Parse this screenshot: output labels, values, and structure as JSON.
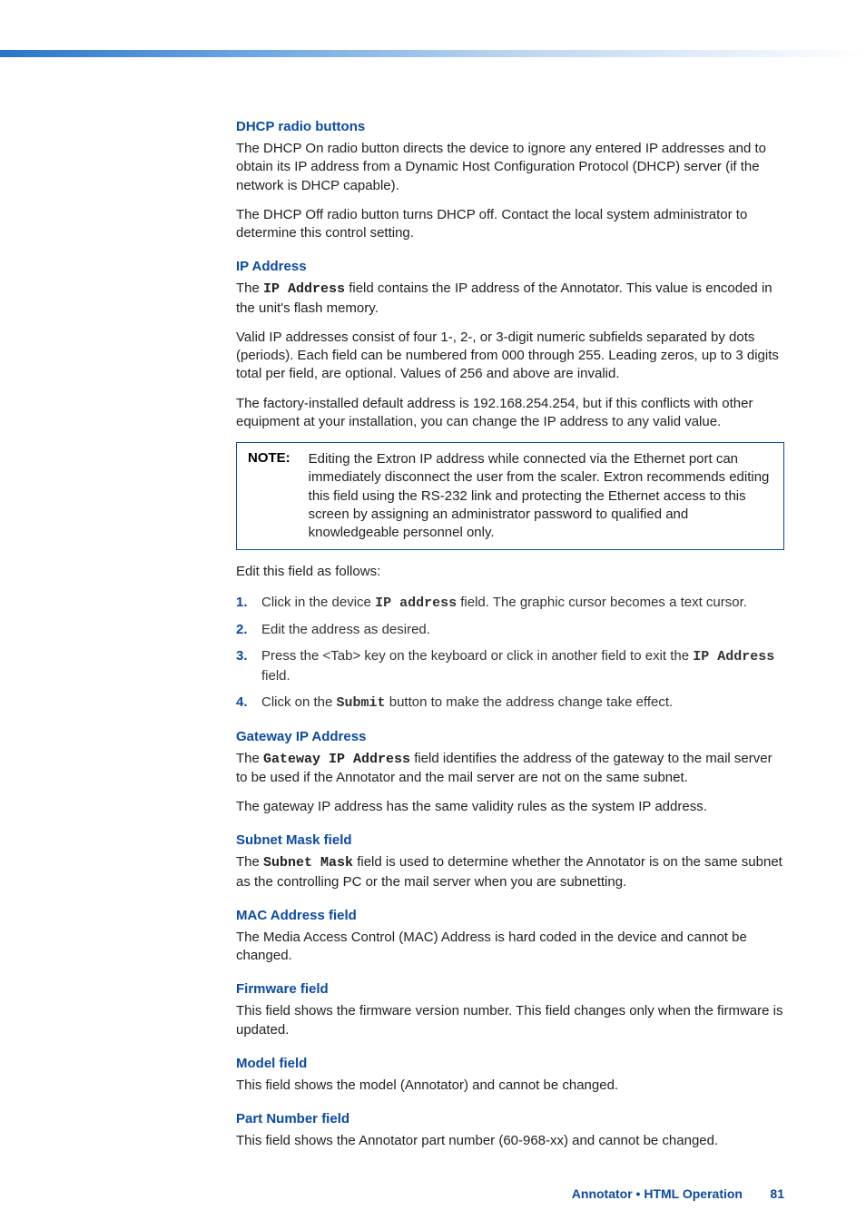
{
  "sections": {
    "dhcp": {
      "head": "DHCP radio buttons",
      "p1": "The DHCP On radio button directs the device to ignore any entered IP addresses and to obtain its IP address from a Dynamic Host Configuration Protocol (DHCP) server (if the network is DHCP capable).",
      "p2": "The DHCP Off radio button turns DHCP off. Contact the local system administrator to determine this control setting."
    },
    "ip": {
      "head": "IP Address",
      "p1_a": "The ",
      "p1_code": "IP Address",
      "p1_b": " field contains the IP address of the Annotator. This value is encoded in the unit's flash memory.",
      "p2": "Valid IP addresses consist of four 1-, 2-, or 3-digit numeric subfields separated by dots (periods). Each field can be numbered from 000 through 255. Leading zeros, up to 3 digits total per field, are optional. Values of 256 and above are invalid.",
      "p3": "The factory-installed default address is 192.168.254.254, but if this conflicts with other equipment at your installation, you can change the IP address to any valid value.",
      "note_label": "NOTE:",
      "note_text": "Editing the Extron IP address while connected via the Ethernet port can immediately disconnect the user from the scaler. Extron recommends editing this field using the RS-232 link and protecting the Ethernet access to this screen by assigning an administrator password to qualified and knowledgeable personnel only.",
      "p4": "Edit this field as follows:",
      "s1_a": "Click in the device ",
      "s1_code": "IP address",
      "s1_b": " field. The graphic cursor becomes a text cursor.",
      "s2": "Edit the address as desired.",
      "s3_a": "Press the <Tab> key on the keyboard or click in another field to exit the ",
      "s3_code": "IP Address",
      "s3_b": " field.",
      "s4_a": "Click on the ",
      "s4_code": "Submit",
      "s4_b": " button to make the address change take effect."
    },
    "gateway": {
      "head": "Gateway IP Address",
      "p1_a": "The ",
      "p1_code": "Gateway IP Address",
      "p1_b": " field identifies the address of the gateway to the mail server to be used if the Annotator and the mail server are not on the same subnet.",
      "p2": "The gateway IP address has the same validity rules as the system IP address."
    },
    "subnet": {
      "head": "Subnet Mask field",
      "p1_a": "The ",
      "p1_code": "Subnet Mask",
      "p1_b": " field is used to determine whether the Annotator is on the same subnet  as the controlling PC or the mail server when you are subnetting."
    },
    "mac": {
      "head": "MAC Address field",
      "p1": "The Media Access Control (MAC) Address is hard coded in the device and cannot be changed."
    },
    "firmware": {
      "head": "Firmware field",
      "p1": "This field shows the firmware version number. This field changes only when the firmware is updated."
    },
    "model": {
      "head": "Model field",
      "p1": "This field shows the model (Annotator) and cannot be changed."
    },
    "part": {
      "head": "Part Number field",
      "p1": "This field shows the Annotator part number (60-968-xx) and cannot be changed."
    }
  },
  "footer": {
    "title": "Annotator • HTML Operation",
    "page": "81"
  }
}
